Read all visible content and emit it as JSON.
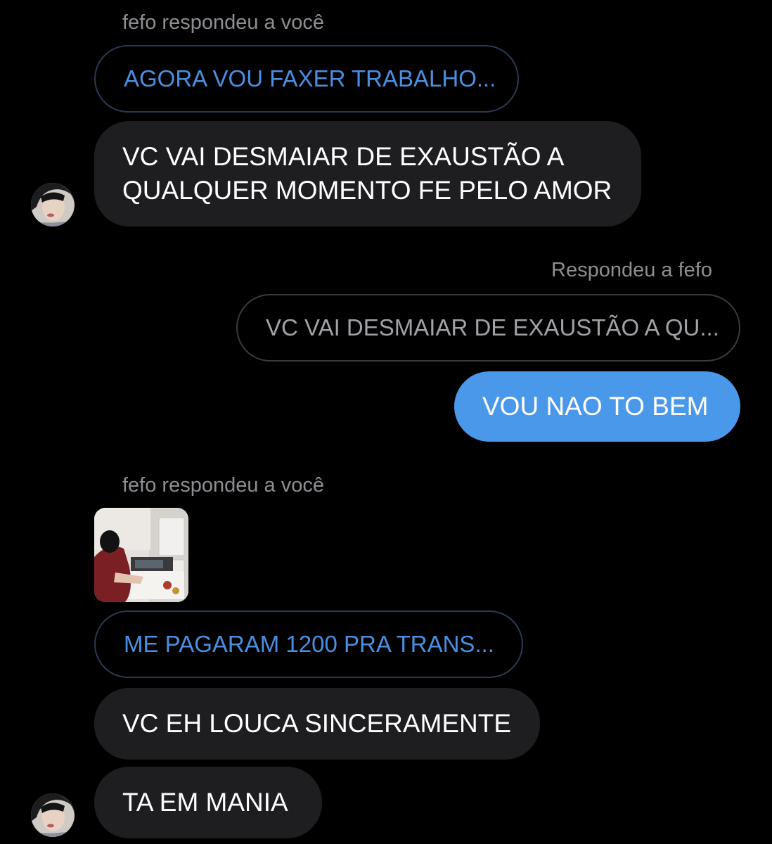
{
  "conversation": {
    "contact_name": "fefo",
    "messages": [
      {
        "reply_label": "fefo respondeu a você",
        "quoted": "AGORA VOU FAXER TRABALHO...",
        "text_lines": [
          "VC VAI DESMAIAR DE EXAUSTÃO A",
          "QUALQUER MOMENTO FE PELO AMOR"
        ]
      },
      {
        "reply_label": "Respondeu a fefo",
        "quoted": "VC VAI DESMAIAR DE EXAUSTÃO A QU...",
        "text": "VOU NAO TO BEM"
      },
      {
        "reply_label": "fefo respondeu a você",
        "quoted": "ME PAGARAM 1200 PRA TRANS...",
        "text": "VC EH LOUCA SINCERAMENTE"
      },
      {
        "text": "TA EM MANIA"
      }
    ]
  },
  "colors": {
    "background": "#000000",
    "incoming_bubble": "#1e1e20",
    "outgoing_bubble": "#4a98ea",
    "quote_text_incoming": "#4a90e2",
    "quote_text_outgoing": "#a1a1a6",
    "reply_label": "#8e8e93"
  },
  "icons": {
    "avatar": "contact-avatar-photo",
    "story_thumbnail": "story-photo-thumbnail"
  }
}
